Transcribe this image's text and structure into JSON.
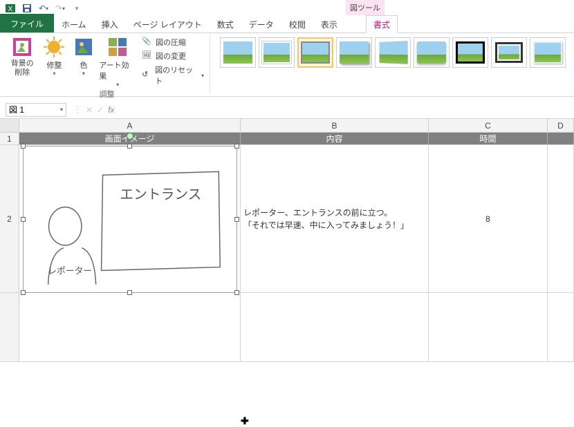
{
  "qat": {
    "app": "Excel"
  },
  "contextual": {
    "group_label": "図ツール"
  },
  "tabs": {
    "file": "ファイル",
    "home": "ホーム",
    "insert": "挿入",
    "page_layout": "ページ レイアウト",
    "formulas": "数式",
    "data": "データ",
    "review": "校閲",
    "view": "表示",
    "format": "書式"
  },
  "ribbon": {
    "remove_bg": "背景の\n削除",
    "corrections": "修整",
    "color": "色",
    "artistic": "アート効果",
    "compress": "図の圧縮",
    "change": "図の変更",
    "reset": "図のリセット",
    "adjust_group": "調整"
  },
  "formula_bar": {
    "name_box": "図 1",
    "fx": "fx"
  },
  "columns": {
    "A": "A",
    "B": "B",
    "C": "C",
    "D": "D"
  },
  "rows_h": {
    "r1": "1",
    "r2": "2"
  },
  "headers": {
    "A": "画面イメージ",
    "B": "内容",
    "C": "時間"
  },
  "data_row": {
    "B": "レポーター、エントランスの前に立つ。\n「それでは早速、中に入ってみましょう！」",
    "C": "8"
  },
  "sketch": {
    "sign_text": "エントランス",
    "person_label": "レポーター"
  }
}
